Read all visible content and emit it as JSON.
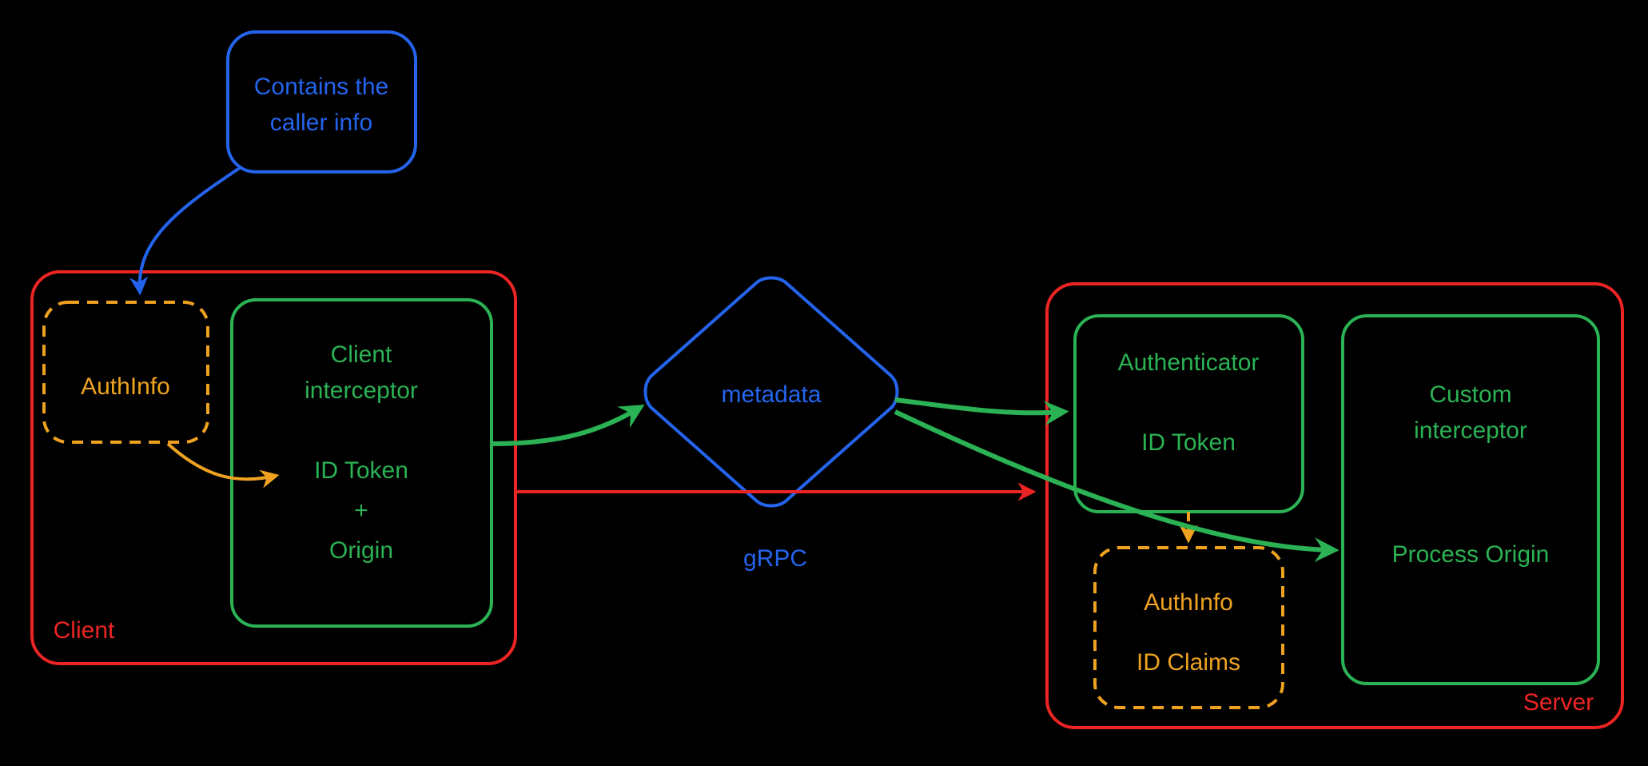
{
  "colors": {
    "red": "#ed2424",
    "blue": "#2464ed",
    "green": "#2bb254",
    "orange": "#eea220"
  },
  "nodes": {
    "callerInfo": {
      "line1": "Contains the",
      "line2": "caller info"
    },
    "clientContainer": {
      "label": "Client"
    },
    "authInfoClient": {
      "label": "AuthInfo"
    },
    "clientInterceptor": {
      "title1": "Client",
      "title2": "interceptor",
      "line1": "ID Token",
      "plus": "+",
      "line2": "Origin"
    },
    "metadataDiamond": {
      "label": "metadata"
    },
    "grpcArrow": {
      "label": "gRPC"
    },
    "serverContainer": {
      "label": "Server"
    },
    "authenticator": {
      "title": "Authenticator",
      "line1": "ID Token"
    },
    "authInfoServer": {
      "title": "AuthInfo",
      "line1": "ID Claims"
    },
    "customInterceptor": {
      "title1": "Custom",
      "title2": "interceptor",
      "line1": "Process Origin"
    }
  }
}
